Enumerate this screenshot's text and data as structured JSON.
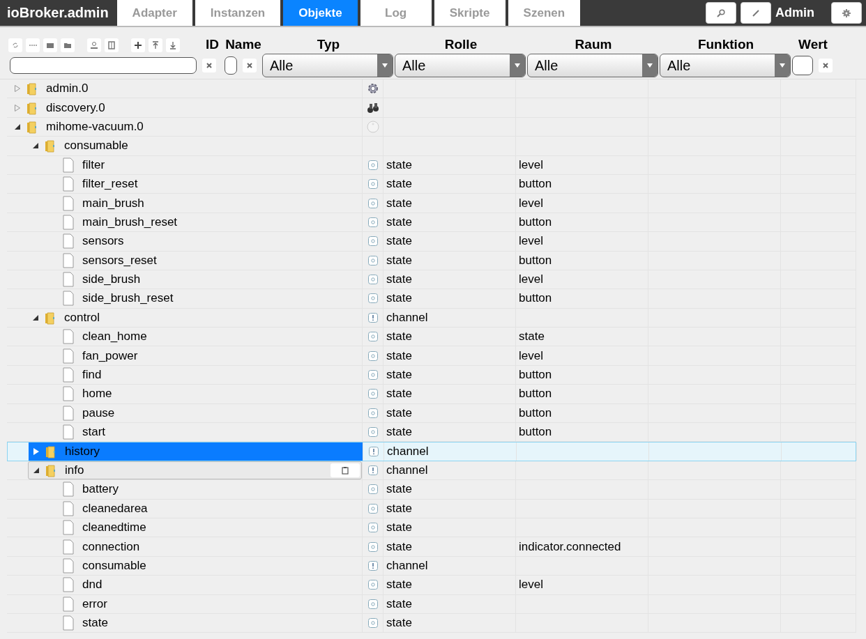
{
  "app_title": "ioBroker.admin",
  "tabs": [
    {
      "label": "Adapter",
      "selected": false
    },
    {
      "label": "Instanzen",
      "selected": false
    },
    {
      "label": "Objekte",
      "selected": true
    },
    {
      "label": "Log",
      "selected": false
    },
    {
      "label": "Skripte",
      "selected": false
    },
    {
      "label": "Szenen",
      "selected": false
    }
  ],
  "user": "Admin",
  "columns": [
    "ID",
    "Name",
    "Typ",
    "Rolle",
    "Raum",
    "Funktion",
    "Wert"
  ],
  "selects": [
    {
      "value": "Alle"
    },
    {
      "value": "Alle"
    },
    {
      "value": "Alle"
    },
    {
      "value": "Alle"
    }
  ],
  "tree": [
    {
      "name": "admin.0",
      "kind": "instance",
      "expanded": false,
      "selected": false
    },
    {
      "name": "discovery.0",
      "kind": "instance",
      "expanded": false,
      "selected": false
    },
    {
      "name": "mihome-vacuum.0",
      "kind": "instance",
      "expanded": true,
      "selected": false,
      "children": [
        {
          "name": "consumable",
          "kind": "folder",
          "expanded": true,
          "selected": false,
          "children": [
            {
              "name": "filter",
              "kind": "state",
              "type": "state",
              "role": "level"
            },
            {
              "name": "filter_reset",
              "kind": "state",
              "type": "state",
              "role": "button"
            },
            {
              "name": "main_brush",
              "kind": "state",
              "type": "state",
              "role": "level"
            },
            {
              "name": "main_brush_reset",
              "kind": "state",
              "type": "state",
              "role": "button"
            },
            {
              "name": "sensors",
              "kind": "state",
              "type": "state",
              "role": "level"
            },
            {
              "name": "sensors_reset",
              "kind": "state",
              "type": "state",
              "role": "button"
            },
            {
              "name": "side_brush",
              "kind": "state",
              "type": "state",
              "role": "level"
            },
            {
              "name": "side_brush_reset",
              "kind": "state",
              "type": "state",
              "role": "button"
            }
          ]
        },
        {
          "name": "control",
          "kind": "channel",
          "expanded": true,
          "selected": false,
          "type": "channel",
          "children": [
            {
              "name": "clean_home",
              "kind": "state",
              "type": "state",
              "role": "state"
            },
            {
              "name": "fan_power",
              "kind": "state",
              "type": "state",
              "role": "level"
            },
            {
              "name": "find",
              "kind": "state",
              "type": "state",
              "role": "button"
            },
            {
              "name": "home",
              "kind": "state",
              "type": "state",
              "role": "button"
            },
            {
              "name": "pause",
              "kind": "state",
              "type": "state",
              "role": "button"
            },
            {
              "name": "start",
              "kind": "state",
              "type": "state",
              "role": "button"
            }
          ]
        },
        {
          "name": "history",
          "kind": "channel",
          "expanded": false,
          "selected": true,
          "type": "channel"
        },
        {
          "name": "info",
          "kind": "channel",
          "expanded": true,
          "selected": false,
          "hovered": true,
          "type": "channel",
          "children": [
            {
              "name": "battery",
              "kind": "state",
              "type": "state"
            },
            {
              "name": "cleanedarea",
              "kind": "state",
              "type": "state"
            },
            {
              "name": "cleanedtime",
              "kind": "state",
              "type": "state"
            },
            {
              "name": "connection",
              "kind": "state",
              "type": "state",
              "role": "indicator.connected"
            },
            {
              "name": "consumable",
              "kind": "channel-leaf",
              "type": "channel"
            },
            {
              "name": "dnd",
              "kind": "state",
              "type": "state",
              "role": "level"
            },
            {
              "name": "error",
              "kind": "state",
              "type": "state"
            },
            {
              "name": "state",
              "kind": "state",
              "type": "state"
            }
          ]
        }
      ]
    }
  ]
}
